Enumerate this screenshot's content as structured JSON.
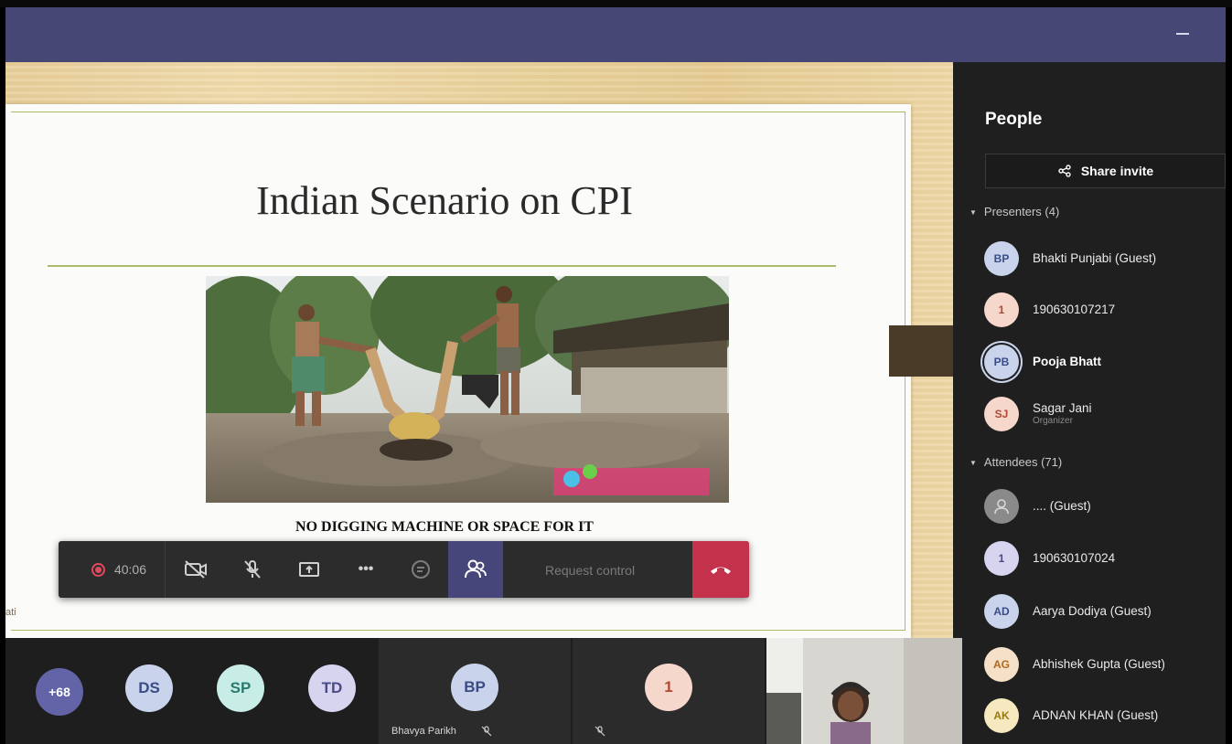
{
  "window": {
    "minimize_label": "Minimize"
  },
  "slide": {
    "title": "Indian Scenario on CPI",
    "caption": "NO DIGGING MACHINE OR SPACE FOR IT",
    "subtext": "",
    "photo_label": "photo-of-manual-digging"
  },
  "stage": {
    "presenter_fragment": "ati"
  },
  "toolbar": {
    "timer": "40:06",
    "request_control": "Request control",
    "more_label": "•••",
    "colors": {
      "hangup": "#c4314b",
      "active": "#46467a",
      "record": "#e04a5e"
    }
  },
  "people_panel": {
    "title": "People",
    "share_invite": "Share invite",
    "presenters_header": "Presenters (4)",
    "attendees_header": "Attendees (71)",
    "presenters": [
      {
        "initials": "BP",
        "name": "Bhakti Punjabi (Guest)",
        "role": "",
        "bg": "#c9d3ec",
        "fg": "#3a4c86"
      },
      {
        "initials": "1",
        "name": "190630107217",
        "role": "",
        "bg": "#f6d7cc",
        "fg": "#b04a32"
      },
      {
        "initials": "PB",
        "name": "Pooja Bhatt",
        "role": "",
        "bg": "#c9d3ec",
        "fg": "#3a4c86"
      },
      {
        "initials": "SJ",
        "name": "Sagar Jani",
        "role": "Organizer",
        "bg": "#f6d7cc",
        "fg": "#b04a32"
      }
    ],
    "attendees": [
      {
        "initials": "",
        "name": ".... (Guest)",
        "bg": "#8a8a8a",
        "fg": "#cfcfcf"
      },
      {
        "initials": "1",
        "name": "190630107024",
        "bg": "#d6d4ee",
        "fg": "#4a4a8a"
      },
      {
        "initials": "AD",
        "name": "Aarya Dodiya (Guest)",
        "bg": "#c9d3ec",
        "fg": "#3a4c86"
      },
      {
        "initials": "AG",
        "name": "Abhishek Gupta (Guest)",
        "bg": "#f6e0c8",
        "fg": "#b06a20"
      },
      {
        "initials": "AK",
        "name": "ADNAN KHAN (Guest)",
        "bg": "#f6e8bf",
        "fg": "#9a7a10"
      }
    ]
  },
  "gallery": {
    "overflow": "+68",
    "avatars": [
      {
        "initials": "DS",
        "bg": "#c9d3ec",
        "fg": "#3a4c86"
      },
      {
        "initials": "SP",
        "bg": "#c8ece6",
        "fg": "#2a7a70"
      },
      {
        "initials": "TD",
        "bg": "#d6d4ee",
        "fg": "#4a4a8a"
      }
    ],
    "speaker_tile": {
      "initials": "BP",
      "name": "Bhavya Parikh"
    },
    "participant_tile": {
      "initials": "1"
    }
  }
}
